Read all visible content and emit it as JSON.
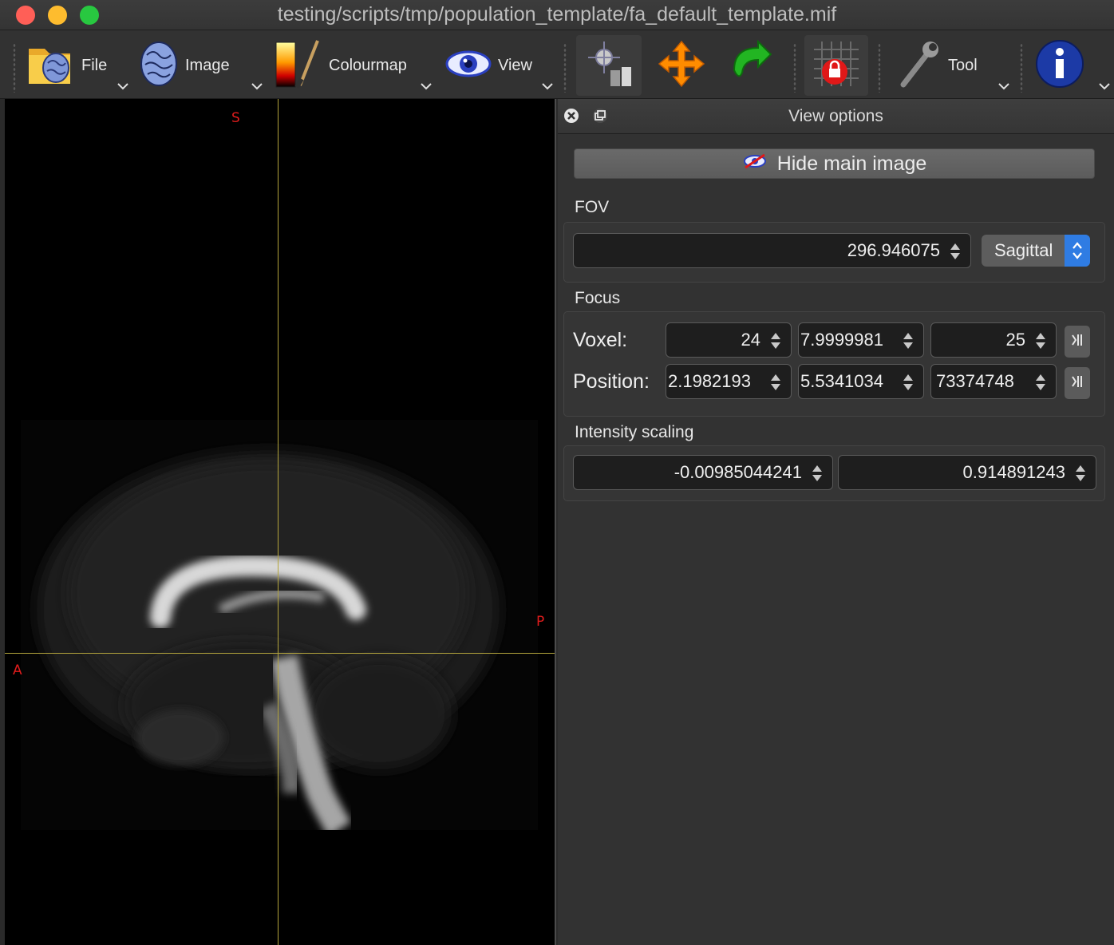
{
  "window": {
    "title": "testing/scripts/tmp/population_template/fa_default_template.mif"
  },
  "toolbar": {
    "file_label": "File",
    "image_label": "Image",
    "colourmap_label": "Colourmap",
    "view_label": "View",
    "tool_label": "Tool"
  },
  "viewport": {
    "label_superior": "S",
    "label_anterior": "A",
    "label_posterior": "P"
  },
  "panel": {
    "title": "View options",
    "hide_button": "Hide main image",
    "fov": {
      "label": "FOV",
      "value": "296.946075",
      "plane": "Sagittal"
    },
    "focus": {
      "label": "Focus",
      "voxel_label": "Voxel:",
      "voxel": [
        "24",
        "7.9999981",
        "25"
      ],
      "position_label": "Position:",
      "position": [
        "2.1982193",
        "5.5341034",
        "73374748"
      ]
    },
    "intensity": {
      "label": "Intensity scaling",
      "min": "-0.00985044241",
      "max": "0.914891243"
    }
  },
  "colors": {
    "crosshair": "#b3a43c",
    "orientation_label": "#e01c1c",
    "combo_accent": "#2f7ce3"
  }
}
